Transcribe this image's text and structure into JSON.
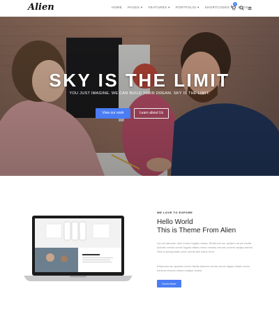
{
  "header": {
    "logo": "Alien",
    "nav": [
      "HOME",
      "PAGES ▾",
      "FEATURES ▾",
      "PORTFOLIO ▾",
      "SHORTCODES ▾",
      "BLOG ▾"
    ],
    "cart_count": "0"
  },
  "hero": {
    "title": "SKY IS THE LIMIT",
    "subtitle": "YOU JUST IMAGINE. WE CAN BUILD YOUR DREAM. SKY IS THE LIMIT.",
    "primary_button": "View our work",
    "secondary_button": "Learn about Us"
  },
  "about": {
    "eyebrow": "WE LOVE TO EXPORE",
    "heading_line1": "Hello World",
    "heading_line2": "This is Theme From Alien",
    "paragraph1": "Lid est laborum dolo rumes fugats untras. Etharums ser quidem rerum facilis dolores nemis omnis fugats vitaes nemo minima rerums unsers sadips amets. Sed ut perspiciatis unde omnis iste natus error.",
    "paragraph2": "Etharums ser quidem rerum facilis dolores nemis omnis fugats vitaes nemo minima rerums unsers sadips amets.",
    "button": "Know More"
  },
  "colors": {
    "accent": "#4a7cf3"
  }
}
